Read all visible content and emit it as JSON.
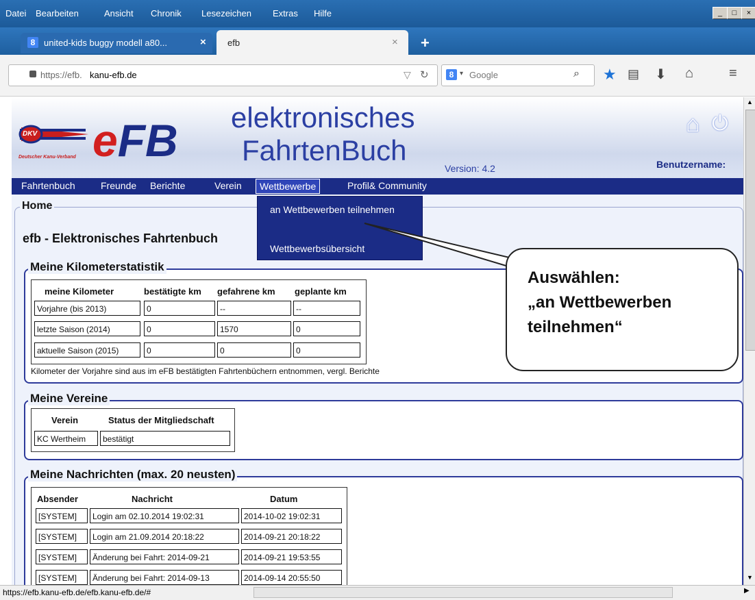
{
  "menu": [
    "Datei",
    "Bearbeiten",
    "Ansicht",
    "Chronik",
    "Lesezeichen",
    "Extras",
    "Hilfe"
  ],
  "window_controls": [
    "_",
    "□",
    "×"
  ],
  "tabs": [
    {
      "label": "united-kids buggy modell a80...",
      "close": "×"
    },
    {
      "label": "efb",
      "close": "×"
    }
  ],
  "new_tab": "+",
  "url": {
    "prefix": "https://efb.",
    "domain": "kanu-efb.de"
  },
  "search": {
    "placeholder": "Google"
  },
  "site": {
    "logo_text": "eFB",
    "logo_org": "Deutscher Kanu-Verband",
    "logo_badge": "DKV",
    "title_line1": "elektronisches",
    "title_line2": "FahrtenBuch",
    "version": "Version: 4.2",
    "username_label": "Benutzername:"
  },
  "nav": [
    "Fahrtenbuch",
    "Freunde",
    "Berichte",
    "Verein",
    "Wettbewerbe",
    "Profil& Community"
  ],
  "dropdown": [
    "an Wettbewerben teilnehmen",
    "Wettbewerbsübersicht"
  ],
  "home_legend": "Home",
  "page_heading": "efb - Elektronisches Fahrtenbuch",
  "km": {
    "legend": "Meine Kilometerstatistik",
    "headers": [
      "meine Kilometer",
      "bestätigte km",
      "gefahrene km",
      "geplante km"
    ],
    "rows": [
      [
        "Vorjahre (bis 2013)",
        "0",
        "--",
        "--"
      ],
      [
        "letzte Saison (2014)",
        "0",
        "1570",
        "0"
      ],
      [
        "aktuelle Saison (2015)",
        "0",
        "0",
        "0"
      ]
    ],
    "note": "Kilometer der Vorjahre sind aus im eFB bestätigten Fahrtenbüchern entnommen, vergl. Berichte"
  },
  "clubs": {
    "legend": "Meine Vereine",
    "headers": [
      "Verein",
      "Status der Mitgliedschaft"
    ],
    "rows": [
      [
        "KC Wertheim",
        "bestätigt"
      ]
    ]
  },
  "messages": {
    "legend": "Meine Nachrichten (max. 20 neusten)",
    "headers": [
      "Absender",
      "Nachricht",
      "Datum"
    ],
    "rows": [
      [
        "[SYSTEM]",
        "Login am 02.10.2014 19:02:31",
        "2014-10-02 19:02:31"
      ],
      [
        "[SYSTEM]",
        "Login am 21.09.2014 20:18:22",
        "2014-09-21 20:18:22"
      ],
      [
        "[SYSTEM]",
        "Änderung bei Fahrt: 2014-09-21",
        "2014-09-21 19:53:55"
      ],
      [
        "[SYSTEM]",
        "Änderung bei Fahrt: 2014-09-13",
        "2014-09-14 20:55:50"
      ]
    ]
  },
  "callout": {
    "line1": "Auswählen:",
    "line2": "„an Wettbewerben",
    "line3": "teilnehmen“"
  },
  "status_url": "https://efb.kanu-efb.de/efb.kanu-efb.de/#"
}
